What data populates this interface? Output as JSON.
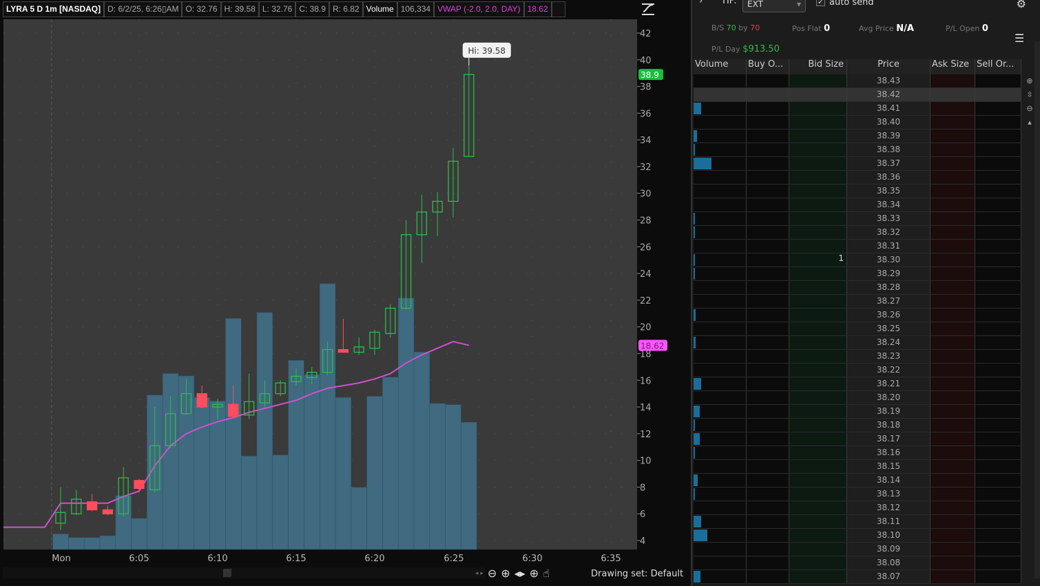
{
  "header": {
    "symbol": "LYRA 5 D 1m [NASDAQ]",
    "date": "D: 6/2/25, 6:26▯AM",
    "open": "O: 32.76",
    "high": "H: 39.58",
    "low": "L: 32.76",
    "close": "C: 38.9",
    "range": "R: 6.82",
    "volume_label": "Volume",
    "volume_value": "106,334",
    "vwap_label": "VWAP (-2.0, 2.0, DAY)",
    "vwap_value": "18.62"
  },
  "chart_data": {
    "type": "candlestick",
    "y_ticks": [
      42,
      40,
      38,
      36,
      34,
      32,
      30,
      28,
      26,
      24,
      22,
      20,
      18,
      16,
      14,
      12,
      10,
      8,
      6,
      4
    ],
    "ylim": [
      4,
      42
    ],
    "x_ticks": [
      "Mon",
      "6:05",
      "6:10",
      "6:15",
      "6:20",
      "6:25",
      "6:30",
      "6:35"
    ],
    "times": [
      "6:00",
      "6:01",
      "6:02",
      "6:03",
      "6:04",
      "6:05",
      "6:06",
      "6:07",
      "6:08",
      "6:09",
      "6:10",
      "6:11",
      "6:12",
      "6:13",
      "6:14",
      "6:15",
      "6:16",
      "6:17",
      "6:18",
      "6:19",
      "6:20",
      "6:21",
      "6:22",
      "6:23",
      "6:24",
      "6:25",
      "6:26"
    ],
    "ohlc": [
      [
        5.3,
        8,
        4.8,
        6.1
      ],
      [
        6,
        7.8,
        5.9,
        7.1
      ],
      [
        6.9,
        7.5,
        6.2,
        6.3
      ],
      [
        6.3,
        6.6,
        5.9,
        6.0
      ],
      [
        6.0,
        9.5,
        5.8,
        8.7
      ],
      [
        8.5,
        8.6,
        7.6,
        7.9
      ],
      [
        7.8,
        14,
        7.6,
        11.1
      ],
      [
        11.1,
        14.8,
        10.9,
        13.5
      ],
      [
        13.5,
        16.1,
        13.4,
        15
      ],
      [
        15,
        15.6,
        13.9,
        14
      ],
      [
        14,
        14.6,
        13.1,
        14.2
      ],
      [
        14.2,
        15.6,
        13.2,
        13.3
      ],
      [
        13.4,
        16.5,
        13.1,
        14.4
      ],
      [
        14.3,
        16,
        14,
        15
      ],
      [
        15,
        16,
        14.8,
        15.8
      ],
      [
        15.9,
        16.9,
        15.6,
        16.3
      ],
      [
        16.2,
        17,
        15.7,
        16.6
      ],
      [
        16.6,
        18.9,
        16.4,
        18.3
      ],
      [
        18.3,
        20.6,
        18.1,
        18.1
      ],
      [
        18.1,
        19.2,
        17.9,
        18.5
      ],
      [
        18.4,
        19.8,
        17.9,
        19.6
      ],
      [
        19.5,
        21.7,
        19.2,
        21.4
      ],
      [
        21.4,
        28,
        21.3,
        26.9
      ],
      [
        26.9,
        29.9,
        24.8,
        28.6
      ],
      [
        28.6,
        30.1,
        26.8,
        29.4
      ],
      [
        29.4,
        33.4,
        28.2,
        32.4
      ],
      [
        32.76,
        39.58,
        32.76,
        38.9
      ]
    ],
    "volume": [
      13000,
      10000,
      10000,
      11500,
      45000,
      26000,
      129000,
      147000,
      145000,
      127000,
      124000,
      193000,
      78000,
      198000,
      79000,
      158000,
      146000,
      222000,
      127000,
      52000,
      128000,
      144000,
      210000,
      165000,
      122000,
      121000,
      106334
    ],
    "vwap": [
      6.8,
      6.8,
      6.8,
      6.8,
      7.3,
      7.7,
      9.6,
      11.1,
      12,
      12.5,
      12.9,
      13.2,
      13.6,
      13.9,
      14.2,
      14.5,
      15,
      15.4,
      15.6,
      15.8,
      16.1,
      16.5,
      17.3,
      17.9,
      18.4,
      18.9,
      18.62
    ],
    "premarket_price": 5,
    "hi_label": "Hi: 39.58",
    "last_label": "38.9",
    "vwap_label": "18.62",
    "colors": {
      "up": "#2dbd4a",
      "down": "#ff4d5e",
      "volume": "#3f6a80",
      "vwap": "#d050d0",
      "last": "#18c03a",
      "vwap_tag": "#ff55ff",
      "bg": "#3a3a3a"
    }
  },
  "toolbar": {
    "drawing_set": "Drawing set: Default",
    "icons": [
      "zoom-out",
      "zoom-in",
      "pan-horizontal",
      "crosshair",
      "hand"
    ]
  },
  "panel": {
    "tif_label": "TIF:",
    "tif_value": "EXT",
    "auto_send": "auto send",
    "auto_send_checked": true,
    "bs_label": "B/S",
    "bs_buy": "70",
    "bs_by": "by",
    "bs_sell": "70",
    "pos_label": "Pos Flat",
    "pos_value": "0",
    "avg_label": "Avg Price",
    "avg_value": "N/A",
    "plopen_label": "P/L Open",
    "plopen_value": "0",
    "plday_label": "P/L Day",
    "plday_value": "$913.50",
    "columns": [
      "Volume",
      "Buy O...",
      "Bid Size",
      "Price",
      "Ask Size",
      "Sell Or..."
    ],
    "rows": [
      {
        "price": "38.43",
        "vol": 0
      },
      {
        "price": "38.42",
        "vol": 0,
        "selected": true
      },
      {
        "price": "38.41",
        "vol": 0.42
      },
      {
        "price": "38.40",
        "vol": 0
      },
      {
        "price": "38.39",
        "vol": 0.19
      },
      {
        "price": "38.38",
        "vol": 0.08
      },
      {
        "price": "38.37",
        "vol": 1
      },
      {
        "price": "38.36",
        "vol": 0
      },
      {
        "price": "38.35",
        "vol": 0
      },
      {
        "price": "38.34",
        "vol": 0
      },
      {
        "price": "38.33",
        "vol": 0.08
      },
      {
        "price": "38.32",
        "vol": 0.08
      },
      {
        "price": "38.31",
        "vol": 0
      },
      {
        "price": "38.30",
        "vol": 0.08,
        "bid": "1"
      },
      {
        "price": "38.29",
        "vol": 0.08
      },
      {
        "price": "38.28",
        "vol": 0
      },
      {
        "price": "38.27",
        "vol": 0
      },
      {
        "price": "38.26",
        "vol": 0.12
      },
      {
        "price": "38.25",
        "vol": 0
      },
      {
        "price": "38.24",
        "vol": 0.12
      },
      {
        "price": "38.23",
        "vol": 0
      },
      {
        "price": "38.22",
        "vol": 0
      },
      {
        "price": "38.21",
        "vol": 0.42
      },
      {
        "price": "38.20",
        "vol": 0
      },
      {
        "price": "38.19",
        "vol": 0.35
      },
      {
        "price": "38.18",
        "vol": 0.08
      },
      {
        "price": "38.17",
        "vol": 0.35
      },
      {
        "price": "38.16",
        "vol": 0.08
      },
      {
        "price": "38.15",
        "vol": 0
      },
      {
        "price": "38.14",
        "vol": 0.23
      },
      {
        "price": "38.13",
        "vol": 0.08
      },
      {
        "price": "38.12",
        "vol": 0
      },
      {
        "price": "38.11",
        "vol": 0.42
      },
      {
        "price": "38.10",
        "vol": 0.77
      },
      {
        "price": "38.09",
        "vol": 0
      },
      {
        "price": "38.08",
        "vol": 0
      },
      {
        "price": "38.07",
        "vol": 0.38
      }
    ]
  }
}
